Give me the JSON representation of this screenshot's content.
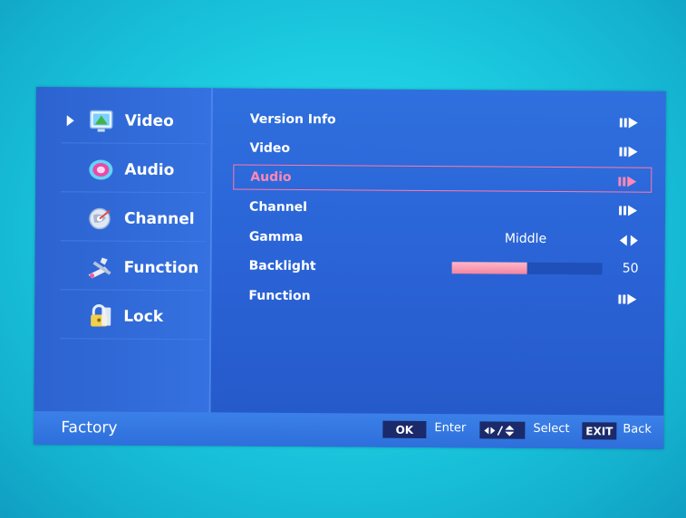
{
  "sidebar": {
    "items": [
      {
        "label": "Video",
        "icon": "monitor-icon"
      },
      {
        "label": "Audio",
        "icon": "speaker-icon"
      },
      {
        "label": "Channel",
        "icon": "satellite-icon"
      },
      {
        "label": "Function",
        "icon": "tools-icon"
      },
      {
        "label": "Lock",
        "icon": "padlock-icon"
      }
    ],
    "selected_index": 0
  },
  "menu": {
    "rows": [
      {
        "label": "Version Info",
        "type": "submenu"
      },
      {
        "label": "Video",
        "type": "submenu"
      },
      {
        "label": "Audio",
        "type": "submenu",
        "selected": true
      },
      {
        "label": "Channel",
        "type": "submenu"
      },
      {
        "label": "Gamma",
        "value": "Middle",
        "type": "option"
      },
      {
        "label": "Backlight",
        "value": "50",
        "level": 0.5,
        "type": "slider"
      },
      {
        "label": "Function",
        "type": "submenu"
      }
    ]
  },
  "footer": {
    "title": "Factory",
    "ok_key": "OK",
    "enter_hint": "Enter",
    "select_hint": "Select",
    "exit_key": "EXIT",
    "back_hint": "Back"
  },
  "colors": {
    "background": "#1ccbe0",
    "panel": "#2a63d6",
    "highlight": "#ff7aa6",
    "bar_fill": "#f4849f"
  }
}
